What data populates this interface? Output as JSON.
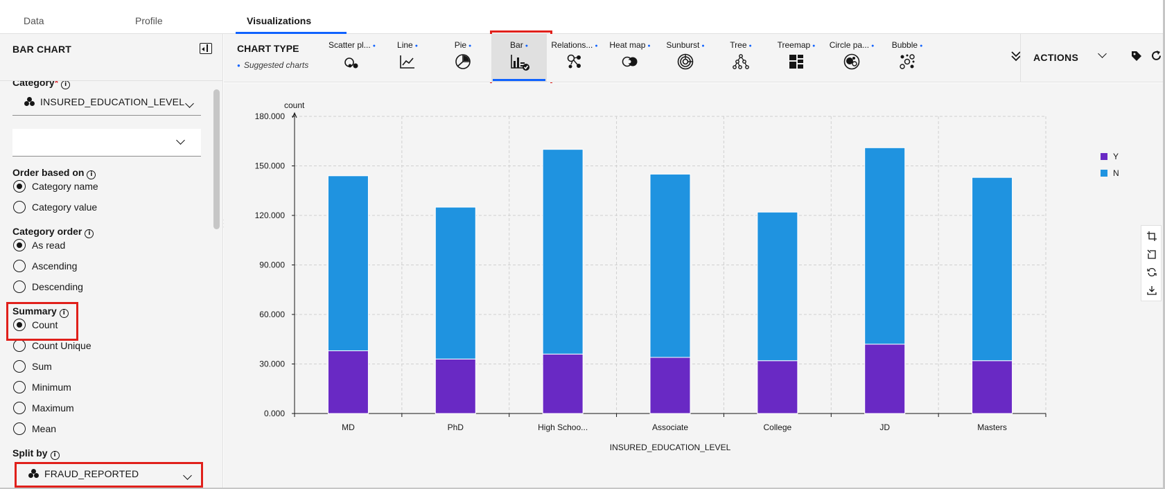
{
  "tabs": [
    {
      "label": "Data"
    },
    {
      "label": "Profile"
    },
    {
      "label": "Visualizations"
    }
  ],
  "left_panel": {
    "title": "BAR CHART",
    "category_label": "Category",
    "category_value": "INSURED_EDUCATION_LEVEL",
    "second_select_value": "",
    "order_based_on": {
      "label": "Order based on",
      "options": [
        "Category name",
        "Category value"
      ],
      "selected": "Category name"
    },
    "category_order": {
      "label": "Category order",
      "options": [
        "As read",
        "Ascending",
        "Descending"
      ],
      "selected": "As read"
    },
    "summary": {
      "label": "Summary",
      "options": [
        "Count",
        "Count Unique",
        "Sum",
        "Minimum",
        "Maximum",
        "Mean"
      ],
      "selected": "Count"
    },
    "split_by": {
      "label": "Split by",
      "value": "FRAUD_REPORTED"
    }
  },
  "toolbar": {
    "chart_type_label": "CHART TYPE",
    "suggested_label": "Suggested charts",
    "chart_types": [
      {
        "label": "Scatter pl...",
        "icon": "scatter-icon"
      },
      {
        "label": "Line",
        "icon": "line-chart-icon"
      },
      {
        "label": "Pie",
        "icon": "pie-chart-icon"
      },
      {
        "label": "Bar",
        "icon": "bar-chart-icon",
        "selected": true
      },
      {
        "label": "Relations...",
        "icon": "relationship-icon"
      },
      {
        "label": "Heat map",
        "icon": "heat-map-icon"
      },
      {
        "label": "Sunburst",
        "icon": "sunburst-icon"
      },
      {
        "label": "Tree",
        "icon": "tree-icon"
      },
      {
        "label": "Treemap",
        "icon": "treemap-icon"
      },
      {
        "label": "Circle pa...",
        "icon": "circle-packing-icon"
      },
      {
        "label": "Bubble",
        "icon": "bubble-icon"
      }
    ],
    "actions_label": "ACTIONS"
  },
  "chart_data": {
    "type": "bar",
    "stacked": true,
    "title": "",
    "xlabel": "INSURED_EDUCATION_LEVEL",
    "ylabel": "count",
    "categories": [
      "MD",
      "PhD",
      "High Schoo...",
      "Associate",
      "College",
      "JD",
      "Masters"
    ],
    "series": [
      {
        "name": "Y",
        "color": "#6929c4",
        "values": [
          38,
          33,
          36,
          34,
          32,
          42,
          32
        ]
      },
      {
        "name": "N",
        "color": "#1f93e0",
        "values": [
          106,
          92,
          124,
          111,
          90,
          119,
          111
        ]
      }
    ],
    "ylim": [
      0,
      180
    ],
    "yticks": [
      "0.000",
      "30.000",
      "60.000",
      "90.000",
      "120.000",
      "150.000",
      "180.000"
    ],
    "grid": true,
    "legend": "top-right"
  }
}
